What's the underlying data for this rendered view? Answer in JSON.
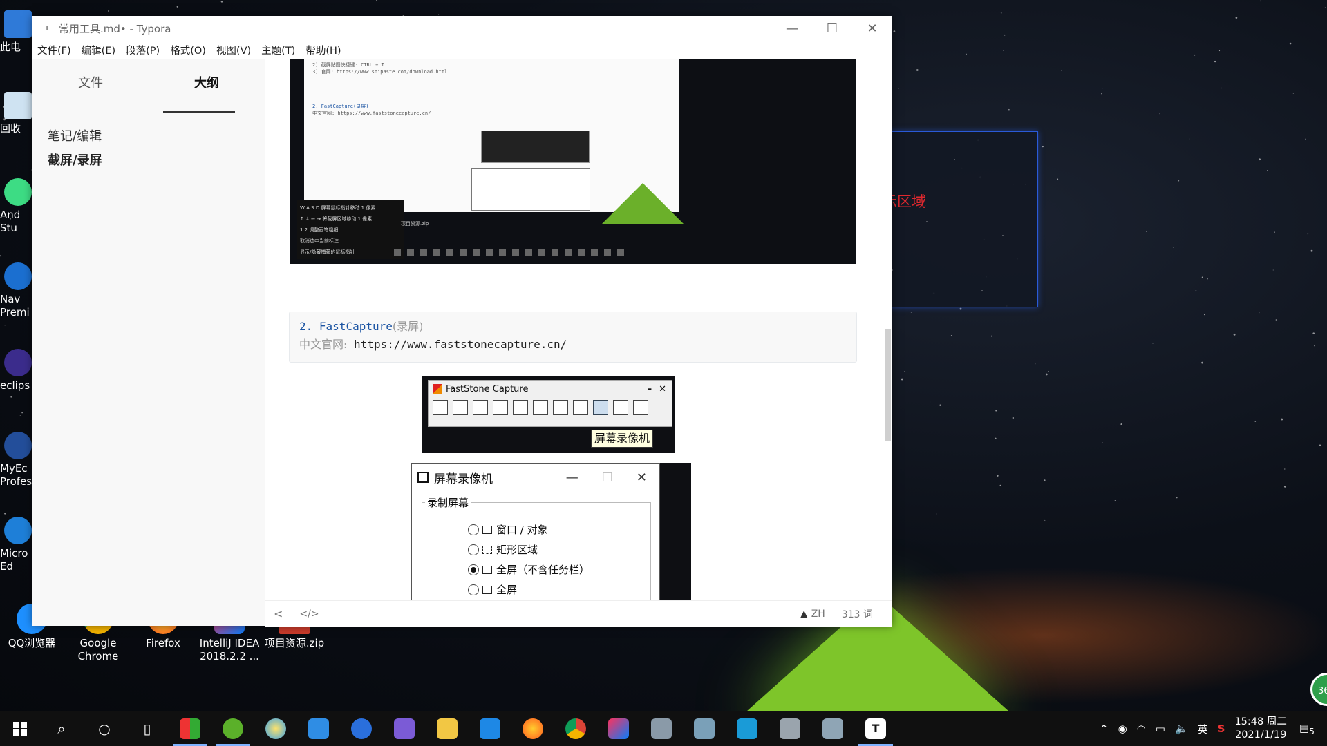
{
  "desktop": {
    "left_icons": [
      {
        "name": "此电"
      },
      {
        "name": "回收"
      },
      {
        "name": "And Stu"
      },
      {
        "name": "Nav Premi"
      },
      {
        "name": "eclips"
      },
      {
        "name": "MyEc Profes"
      },
      {
        "name": "Micro Ed"
      }
    ],
    "bottom_icons": [
      {
        "name": "QQ浏览器"
      },
      {
        "name": "Google Chrome"
      },
      {
        "name": "Firefox"
      },
      {
        "name": "IntelliJ IDEA 2018.2.2 ..."
      },
      {
        "name": "项目资源.zip"
      }
    ],
    "badge": "36"
  },
  "window": {
    "title": "常用工具.md• - Typora",
    "app_icon_letter": "T",
    "menu": [
      "文件(F)",
      "编辑(E)",
      "段落(P)",
      "格式(O)",
      "视图(V)",
      "主题(T)",
      "帮助(H)"
    ]
  },
  "sidebar": {
    "tabs": [
      "文件",
      "大纲"
    ],
    "active_tab": "大纲",
    "outline": [
      "笔记/编辑",
      "截屏/录屏"
    ]
  },
  "shot1": {
    "lines": [
      "2) 截屏贴图快捷键: CTRL + T",
      "3) 官网: https://www.snipaste.com/download.html",
      "2. FastCapture(录屏)",
      "中文官网: https://www.faststonecapture.cn/"
    ],
    "keys": [
      "W A S D  屏幕鼠标指针移动 1 像素",
      "↑ ↓ ← →  将截屏区域移动 1 像素",
      "1 2      调整画笔粗细",
      "         取消选中当前标注",
      "         显示/隐藏捕获的鼠标指针"
    ],
    "mini_file": "项目资源.zip"
  },
  "code": {
    "num": "2.",
    "name": "FastCapture",
    "paren": "(录屏)",
    "label": "中文官网:",
    "url": "https://www.faststonecapture.cn/"
  },
  "fsc": {
    "title": "FastStone Capture",
    "minimize": "–",
    "close": "✕",
    "tooltip": "屏幕录像机"
  },
  "recorder": {
    "title": "屏幕录像机",
    "minimize": "—",
    "maximize": "☐",
    "close": "✕",
    "group": "录制屏幕",
    "options": [
      {
        "label": "窗口 / 对象",
        "selected": false
      },
      {
        "label": "矩形区域",
        "selected": false
      },
      {
        "label": "全屏（不含任务栏）",
        "selected": true
      },
      {
        "label": "全屏",
        "selected": false
      }
    ]
  },
  "demo": {
    "label": "演示区域",
    "arrow_color": "#e0282e",
    "border_color": "#2a5ad8"
  },
  "status": {
    "left": "<",
    "code": "</>",
    "warn": "ZH",
    "words": "313 词"
  },
  "taskbar": {
    "time": "15:48 周二",
    "date": "2021/1/19",
    "ime": "英",
    "notif": "5",
    "apps": [
      "app-1",
      "app-2",
      "app-3",
      "app-4",
      "app-5",
      "app-6",
      "app-7",
      "app-8",
      "app-9",
      "app-10",
      "app-11",
      "app-12",
      "app-13",
      "app-14",
      "app-15",
      "app-16",
      "typora"
    ]
  }
}
